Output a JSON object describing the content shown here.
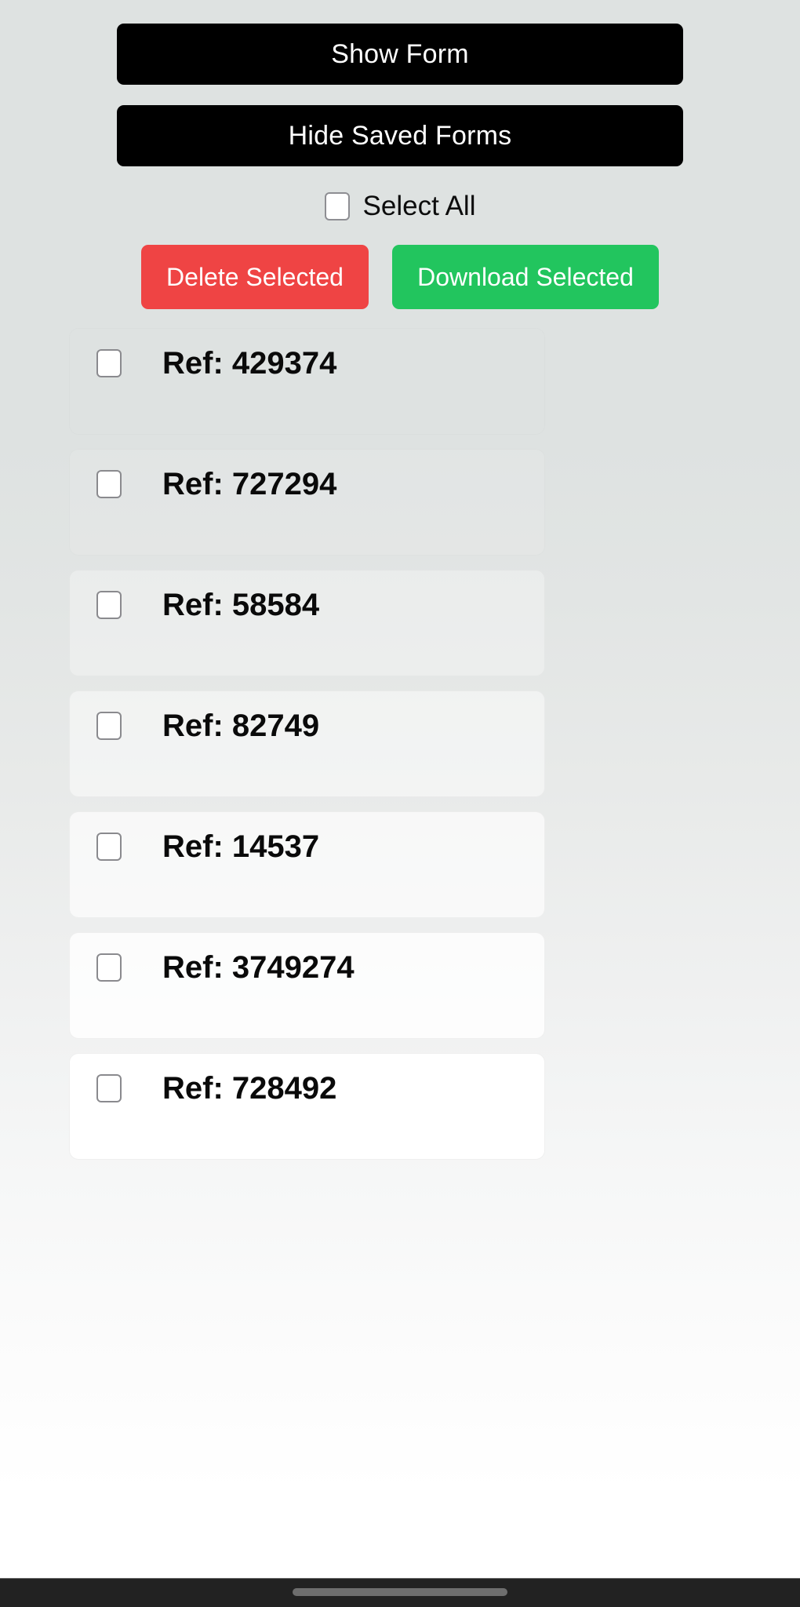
{
  "toolbar": {
    "show_form_label": "Show Form",
    "hide_saved_forms_label": "Hide Saved Forms"
  },
  "select_all": {
    "label": "Select All",
    "checked": false
  },
  "actions": {
    "delete_label": "Delete Selected",
    "download_label": "Download Selected",
    "delete_color": "#ef4444",
    "download_color": "#22c55e"
  },
  "saved_forms": {
    "items": [
      {
        "ref_label": "Ref: 429374",
        "checked": false
      },
      {
        "ref_label": "Ref: 727294",
        "checked": false
      },
      {
        "ref_label": "Ref: 58584",
        "checked": false
      },
      {
        "ref_label": "Ref: 82749",
        "checked": false
      },
      {
        "ref_label": "Ref: 14537",
        "checked": false
      },
      {
        "ref_label": "Ref: 3749274",
        "checked": false
      },
      {
        "ref_label": "Ref: 728492",
        "checked": false
      }
    ]
  },
  "system_bar": {
    "home_indicator": "home-indicator"
  }
}
